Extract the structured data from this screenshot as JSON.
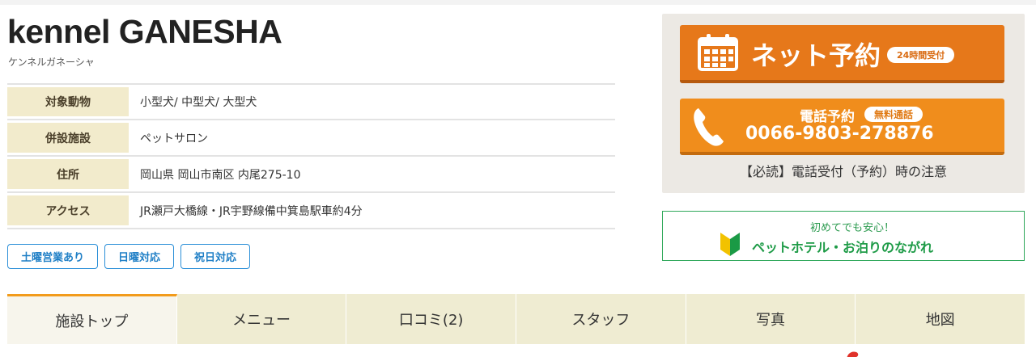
{
  "facility": {
    "name": "kennel GANESHA",
    "kana": "ケンネルガネーシャ"
  },
  "info": [
    {
      "label": "対象動物",
      "value": "小型犬/ 中型犬/ 大型犬"
    },
    {
      "label": "併設施設",
      "value": "ペットサロン"
    },
    {
      "label": "住所",
      "value": "岡山県 岡山市南区 内尾275-10"
    },
    {
      "label": "アクセス",
      "value": "JR瀬戸大橋線・JR宇野線備中箕島駅車約4分"
    }
  ],
  "tags": [
    "土曜営業あり",
    "日曜対応",
    "祝日対応"
  ],
  "reserve": {
    "net_label": "ネット予約",
    "net_badge": "24時間受付",
    "tel_label": "電話予約",
    "tel_badge": "無料通話",
    "tel_number": "0066-9803-278876",
    "notice": "【必読】電話受付（予約）時の注意"
  },
  "beginner": {
    "sub": "初めてでも安心！",
    "main": "ペットホテル・お泊りのながれ"
  },
  "tabs": [
    "施設トップ",
    "メニュー",
    "口コミ(2)",
    "スタッフ",
    "写真",
    "地図"
  ],
  "colors": {
    "net_button": "#e6781a",
    "tel_button": "#f08d1c",
    "label_bg": "#f2ebcc",
    "tag_blue": "#2b8fd8",
    "beginner_green": "#2fa85a",
    "tab_bg": "#efecd2",
    "tab_active_accent": "#f29b1b"
  },
  "icons": [
    "calendar-icon",
    "phone-icon",
    "beginner-mark-icon"
  ]
}
